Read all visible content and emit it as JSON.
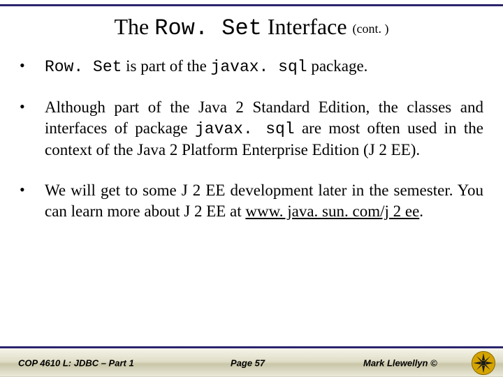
{
  "title": {
    "pre": "The ",
    "mono": "Row. Set",
    "post": " Interface ",
    "cont": "(cont. )"
  },
  "bullets": {
    "b1": {
      "p1": "Row. Set",
      "p2": " is part of the ",
      "p3": "javax. sql",
      "p4": " package."
    },
    "b2": {
      "p1": "Although part of the Java 2 Standard Edition, the classes and interfaces of package ",
      "p2": "javax. sql",
      "p3": " are most often used in the context of the Java 2 Platform Enterprise Edition (J 2 EE)."
    },
    "b3": {
      "p1": "We will get to some J 2 EE development later in the semester.  You can learn more about J 2 EE at ",
      "link": "www. java. sun. com/j 2 ee",
      "p2": "."
    }
  },
  "footer": {
    "left": "COP 4610 L: JDBC – Part 1",
    "center": "Page 57",
    "right": "Mark Llewellyn ©"
  },
  "colors": {
    "rule": "#2a246e",
    "logo": "#d6a400"
  }
}
